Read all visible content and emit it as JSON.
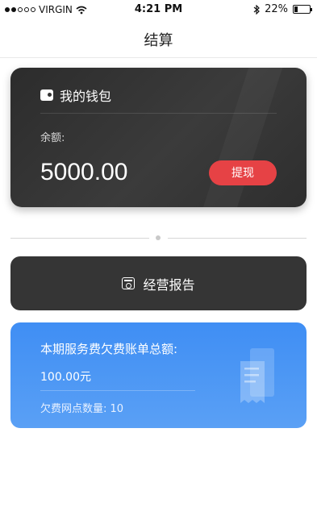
{
  "status_bar": {
    "carrier": "VIRGIN",
    "time": "4:21 PM",
    "battery": "22%",
    "battery_level": 0.22
  },
  "nav": {
    "title": "结算"
  },
  "wallet": {
    "title": "我的钱包",
    "balance_label": "余额:",
    "balance_value": "5000.00",
    "withdraw_label": "提现"
  },
  "report": {
    "label": "经营报告"
  },
  "debt": {
    "title": "本期服务费欠费账单总额:",
    "amount": "100.00元",
    "count_text": "欠费网点数量:  10"
  },
  "colors": {
    "wallet_bg": "#333333",
    "withdraw_button": "#e64245",
    "debt_card": "#4a94f4"
  },
  "icons": [
    "wifi-icon",
    "bluetooth-icon",
    "battery-icon",
    "wallet-icon",
    "report-icon",
    "receipt-icon"
  ]
}
